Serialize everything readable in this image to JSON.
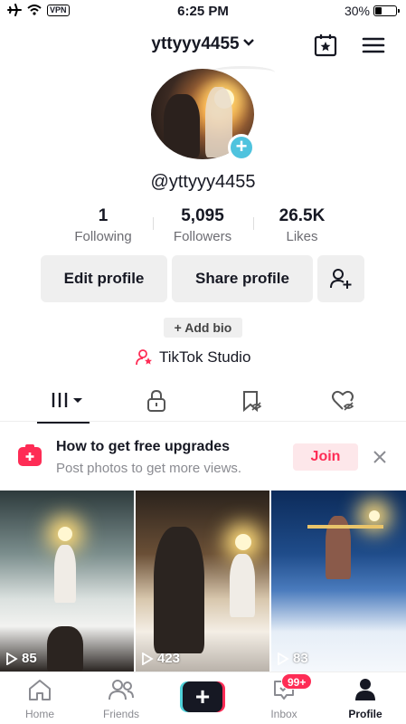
{
  "status_bar": {
    "vpn": "VPN",
    "time": "6:25 PM",
    "battery": "30%"
  },
  "header": {
    "username": "yttyyy4455"
  },
  "profile": {
    "handle": "@yttyyy4455",
    "stats": [
      {
        "value": "1",
        "label": "Following"
      },
      {
        "value": "5,095",
        "label": "Followers"
      },
      {
        "value": "26.5K",
        "label": "Likes"
      }
    ],
    "edit_label": "Edit profile",
    "share_label": "Share profile",
    "add_bio": "+ Add bio",
    "studio": "TikTok Studio"
  },
  "banner": {
    "title": "How to get free upgrades",
    "subtitle": "Post photos to get more views.",
    "join": "Join"
  },
  "videos": [
    {
      "views": "85"
    },
    {
      "views": "423"
    },
    {
      "views": "83"
    }
  ],
  "bottom_nav": {
    "home": "Home",
    "friends": "Friends",
    "inbox": "Inbox",
    "inbox_badge": "99+",
    "profile": "Profile"
  },
  "colors": {
    "accent": "#fe2c55",
    "avatar_plus": "#4fc3de",
    "muted": "#8a8b91"
  }
}
